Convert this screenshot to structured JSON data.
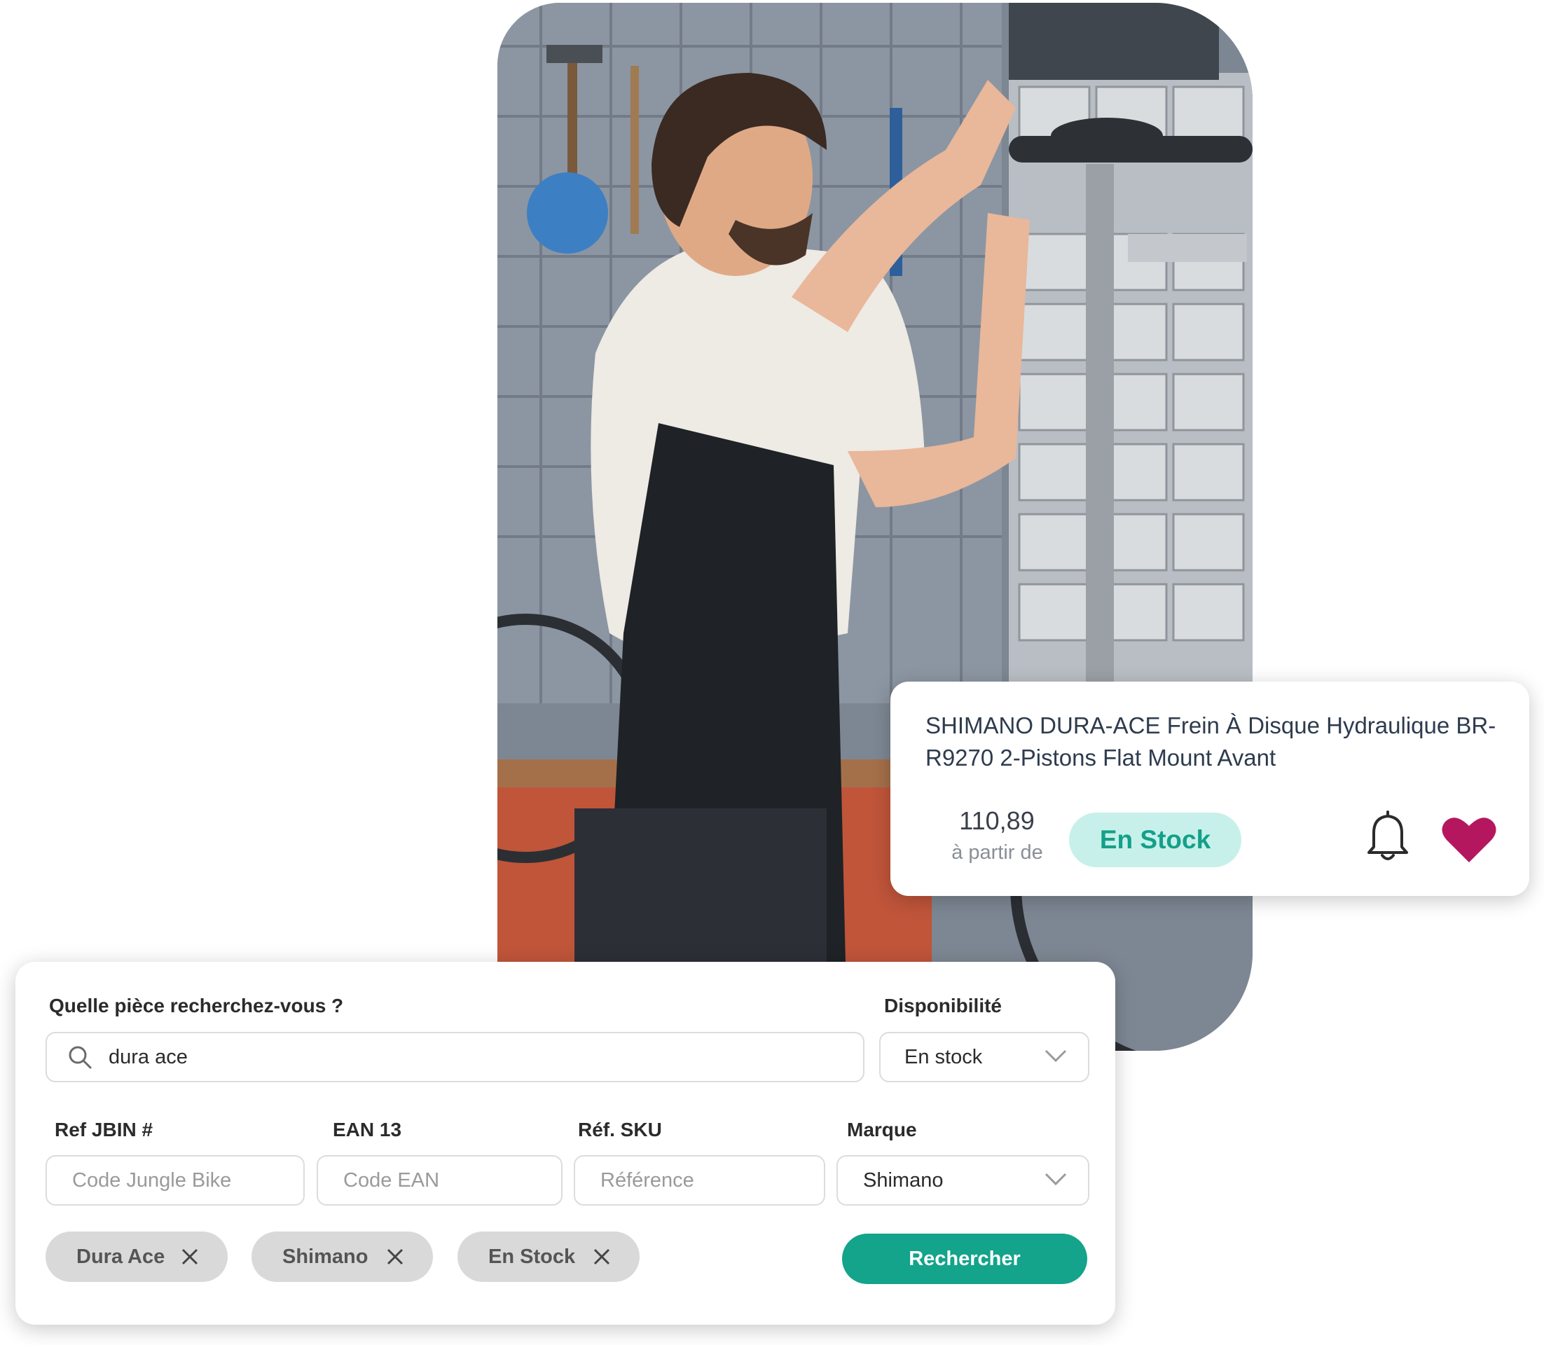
{
  "product_card": {
    "title": "SHIMANO DURA-ACE Frein À Disque Hydraulique BR-R9270 2-Pistons Flat Mount Avant",
    "price": "110,89",
    "price_note": "à partir de",
    "stock_badge": "En Stock",
    "icons": [
      "bell-icon",
      "heart-icon"
    ],
    "colors": {
      "badge_bg": "#c8f0ea",
      "badge_text": "#13a08a",
      "heart": "#b5175f"
    }
  },
  "search_panel": {
    "query_label": "Quelle pièce recherchez-vous ?",
    "query_value": "dura ace",
    "availability_label": "Disponibilité",
    "availability_value": "En stock",
    "ref_label": "Ref JBIN #",
    "ref_placeholder": "Code Jungle Bike",
    "ean_label": "EAN 13",
    "ean_placeholder": "Code EAN",
    "sku_label": "Réf. SKU",
    "sku_placeholder": "Référence",
    "brand_label": "Marque",
    "brand_value": "Shimano",
    "chips": [
      {
        "label": "Dura Ace"
      },
      {
        "label": "Shimano"
      },
      {
        "label": "En Stock"
      }
    ],
    "search_button": "Rechercher",
    "colors": {
      "button": "#14a38b",
      "chip": "#d9d9d9"
    }
  }
}
